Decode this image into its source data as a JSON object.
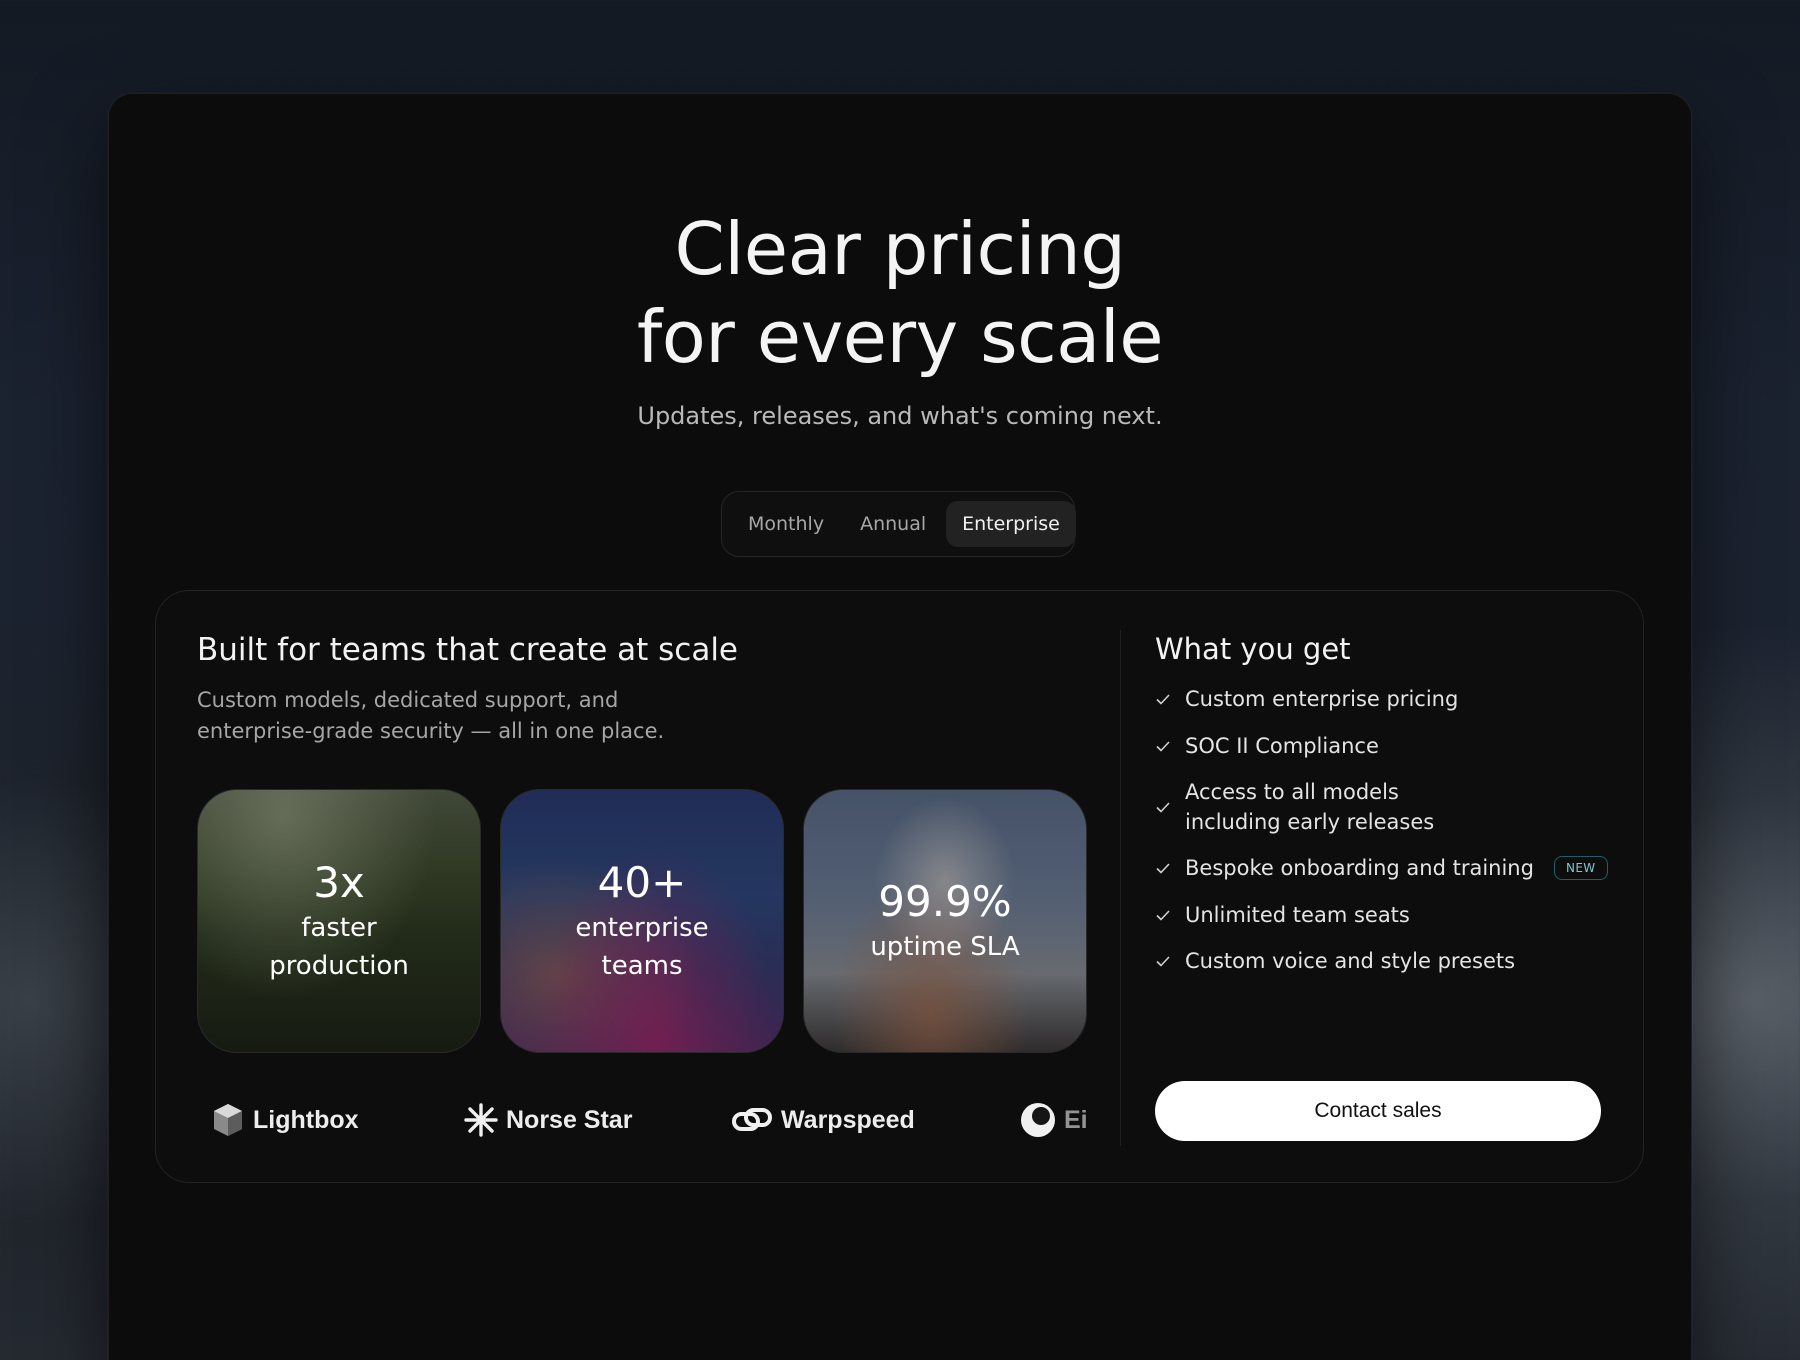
{
  "hero": {
    "title_line1": "Clear pricing",
    "title_line2": "for every scale",
    "subtitle": "Updates, releases, and what's coming next."
  },
  "billing_toggle": {
    "options": [
      "Monthly",
      "Annual",
      "Enterprise"
    ],
    "selected": "Enterprise"
  },
  "enterprise": {
    "title": "Built for teams that create at scale",
    "description_line1": "Custom models, dedicated support, and",
    "description_line2": "enterprise-grade security — all in one place.",
    "stats": [
      {
        "value": "3x",
        "label_line1": "faster",
        "label_line2": "production"
      },
      {
        "value": "40+",
        "label_line1": "enterprise",
        "label_line2": "teams"
      },
      {
        "value": "99.9%",
        "label_line1": "uptime SLA",
        "label_line2": ""
      }
    ],
    "logos": [
      {
        "name": "Lightbox",
        "icon": "cube-icon"
      },
      {
        "name": "Norse Star",
        "icon": "asterisk-icon"
      },
      {
        "name": "Warpspeed",
        "icon": "link-icon"
      },
      {
        "name": "Ei",
        "icon": "moon-icon"
      }
    ]
  },
  "features": {
    "title": "What you get",
    "items": [
      {
        "line1": "Custom enterprise pricing",
        "line2": ""
      },
      {
        "line1": "SOC II Compliance",
        "line2": ""
      },
      {
        "line1": "Access to all models",
        "line2": "including early releases"
      },
      {
        "line1": "Bespoke onboarding and training",
        "line2": "",
        "badge": "NEW"
      },
      {
        "line1": "Unlimited team seats",
        "line2": ""
      },
      {
        "line1": "Custom voice and style presets",
        "line2": ""
      }
    ],
    "cta_label": "Contact sales"
  },
  "colors": {
    "panel_bg": "#0c0c0c",
    "badge_accent": "#7fc6d6",
    "cta_bg": "#ffffff"
  }
}
